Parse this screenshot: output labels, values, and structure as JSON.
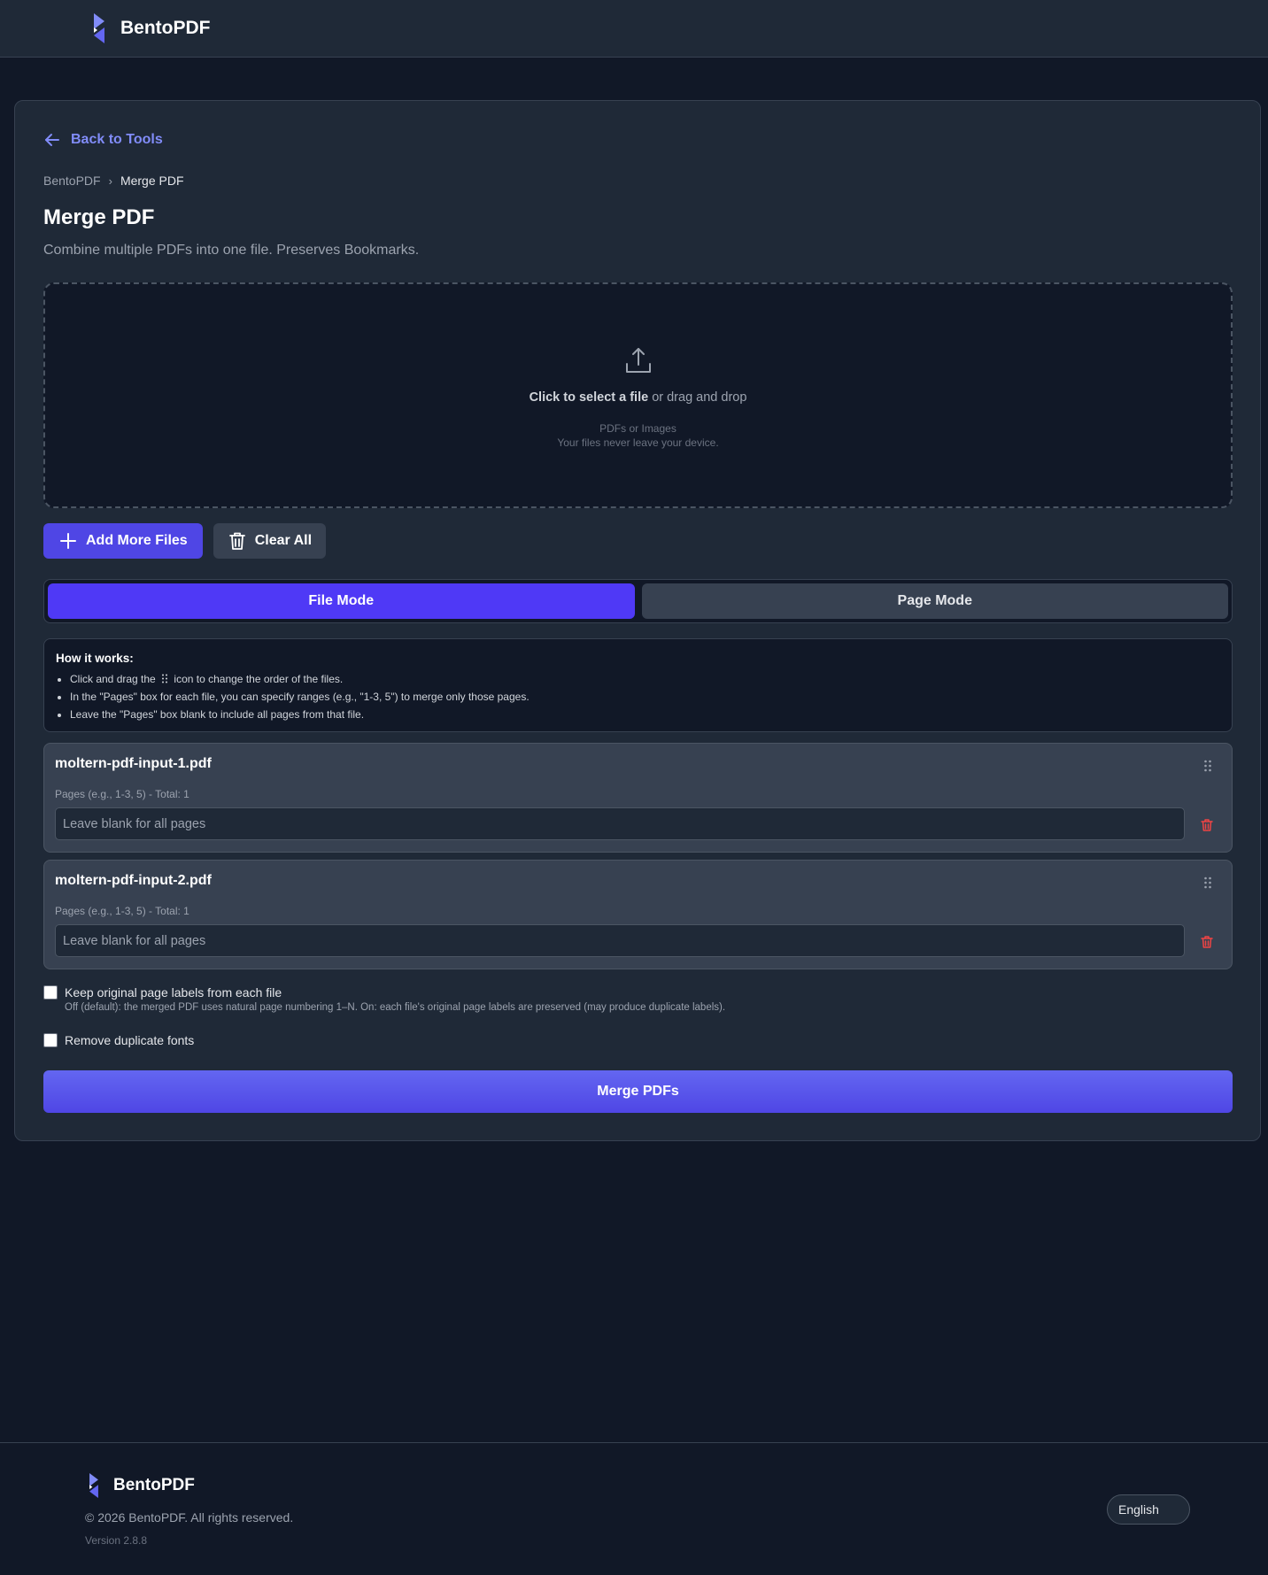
{
  "header": {
    "brand_name": "BentoPDF",
    "logo_icon": "bento-logo-icon"
  },
  "back_link": {
    "label": "Back to Tools",
    "icon": "arrow-left-icon"
  },
  "breadcrumb": {
    "root": "BentoPDF",
    "separator": "›",
    "current": "Merge PDF"
  },
  "page": {
    "title": "Merge PDF",
    "description": "Combine multiple PDFs into one file. Preserves Bookmarks."
  },
  "dropzone": {
    "icon": "upload-icon",
    "main_bold": "Click to select a file",
    "main_rest": " or drag and drop",
    "accepted": "PDFs or Images",
    "privacy": "Your files never leave your device."
  },
  "actions": {
    "add_more_label": "Add More Files",
    "clear_all_label": "Clear All"
  },
  "modes": {
    "file_mode": "File Mode",
    "page_mode": "Page Mode",
    "active": "file_mode"
  },
  "howto": {
    "title": "How it works:",
    "item1_before": "Click and drag the",
    "item1_after": "icon to change the order of the files.",
    "item2": "In the \"Pages\" box for each file, you can specify ranges (e.g., \"1-3, 5\") to merge only those pages.",
    "item3": "Leave the \"Pages\" box blank to include all pages from that file."
  },
  "files": [
    {
      "name": "moltern-pdf-input-1.pdf",
      "pages_label": "Pages (e.g., 1-3, 5) - Total: 1",
      "pages_value": "",
      "pages_placeholder": "Leave blank for all pages"
    },
    {
      "name": "moltern-pdf-input-2.pdf",
      "pages_label": "Pages (e.g., 1-3, 5) - Total: 1",
      "pages_value": "",
      "pages_placeholder": "Leave blank for all pages"
    }
  ],
  "options": {
    "keep_labels": {
      "label": "Keep original page labels from each file",
      "help": "Off (default): the merged PDF uses natural page numbering 1–N. On: each file's original page labels are preserved (may produce duplicate labels).",
      "checked": false
    },
    "remove_fonts": {
      "label": "Remove duplicate fonts",
      "checked": false
    }
  },
  "merge_button": {
    "label": "Merge PDFs"
  },
  "footer": {
    "brand_name": "BentoPDF",
    "copyright": "© 2026 BentoPDF. All rights reserved.",
    "version": "Version 2.8.8",
    "language": "English"
  },
  "colors": {
    "background": "#111827",
    "surface": "#1f2937",
    "accent": "#4f46e5",
    "accent_link": "#818cf8",
    "danger": "#ef4444"
  }
}
